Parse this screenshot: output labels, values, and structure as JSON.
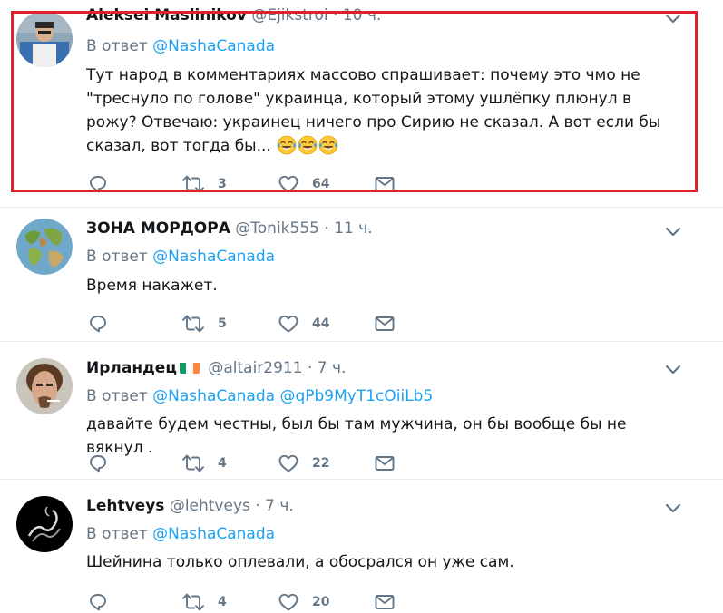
{
  "reply_prefix": "В ответ",
  "tweets": [
    {
      "name": "Aleksei Maslinikov",
      "handle": "@Ejikstroi",
      "time": "10 ч.",
      "reply_to": "@NashaCanada",
      "text": "Тут народ в комментариях массово спрашивает: почему это чмо не \"треснуло по голове\" украинца, который этому ушлёпку плюнул в рожу? Отвечаю: украинец ничего про Сирию не сказал. А вот если бы сказал, вот тогда бы...",
      "emoji": [
        "joy-emoji",
        "joy-emoji",
        "joy-emoji"
      ],
      "retweets": "3",
      "likes": "64",
      "highlight_color": "#e0202a"
    },
    {
      "name": "ЗОНА МОРДОРА",
      "handle": "@Tonik555",
      "time": "11 ч.",
      "reply_to": "@NashaCanada",
      "text": "Время накажет.",
      "retweets": "5",
      "likes": "44"
    },
    {
      "name": "Ирландец",
      "flag": "ireland-flag-emoji",
      "handle": "@altair2911",
      "time": "7 ч.",
      "reply_to": "@NashaCanada",
      "reply_to_2": "@qPb9MyT1cOiiLb5",
      "text": "давайте будем честны, был бы там мужчина, он бы вообще бы не вякнул .",
      "retweets": "4",
      "likes": "22"
    },
    {
      "name": "Lehtveys",
      "handle": "@lehtveys",
      "time": "7 ч.",
      "reply_to": "@NashaCanada",
      "text": "Шейнина только оплевали, а обосрался он уже сам.",
      "retweets": "4",
      "likes": "20"
    }
  ],
  "icons": {
    "reply": "reply-icon",
    "retweet": "retweet-icon",
    "like": "heart-icon",
    "dm": "envelope-icon",
    "menu": "chevron-down-icon"
  },
  "colors": {
    "link": "#1da1f2",
    "secondary_text": "#657786",
    "primary_text": "#14171a",
    "divider": "#e6ecf0"
  }
}
